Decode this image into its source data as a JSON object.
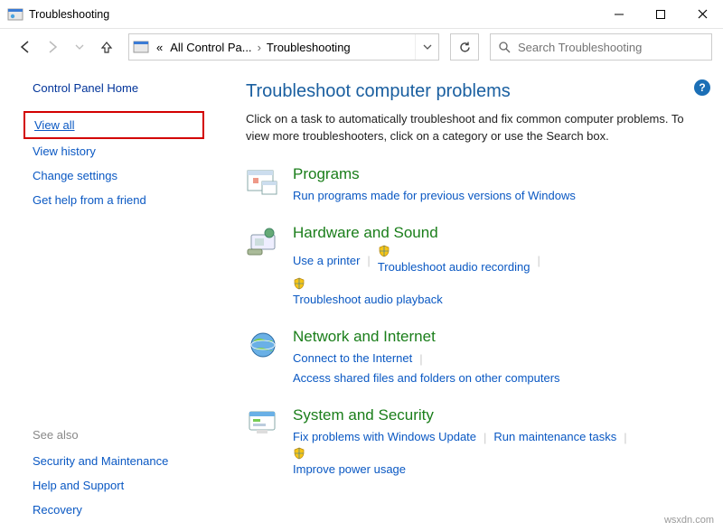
{
  "titlebar": {
    "title": "Troubleshooting"
  },
  "breadcrumb": {
    "prefix": "«",
    "level1": "All Control Pa...",
    "level2": "Troubleshooting"
  },
  "search": {
    "placeholder": "Search Troubleshooting"
  },
  "sidebar": {
    "cph": "Control Panel Home",
    "items": {
      "viewall": "View all",
      "viewhistory": "View history",
      "changesettings": "Change settings",
      "gethelp": "Get help from a friend"
    },
    "seealso_label": "See also",
    "seealso": {
      "security": "Security and Maintenance",
      "help": "Help and Support",
      "recovery": "Recovery"
    }
  },
  "main": {
    "heading": "Troubleshoot computer problems",
    "intro": "Click on a task to automatically troubleshoot and fix common computer problems. To view more troubleshooters, click on a category or use the Search box.",
    "categories": {
      "programs": {
        "title": "Programs",
        "link1": "Run programs made for previous versions of Windows"
      },
      "hardware": {
        "title": "Hardware and Sound",
        "link1": "Use a printer",
        "link2": "Troubleshoot audio recording",
        "link3": "Troubleshoot audio playback"
      },
      "network": {
        "title": "Network and Internet",
        "link1": "Connect to the Internet",
        "link2": "Access shared files and folders on other computers"
      },
      "system": {
        "title": "System and Security",
        "link1": "Fix problems with Windows Update",
        "link2": "Run maintenance tasks",
        "link3": "Improve power usage"
      }
    }
  },
  "watermark": "wsxdn.com"
}
